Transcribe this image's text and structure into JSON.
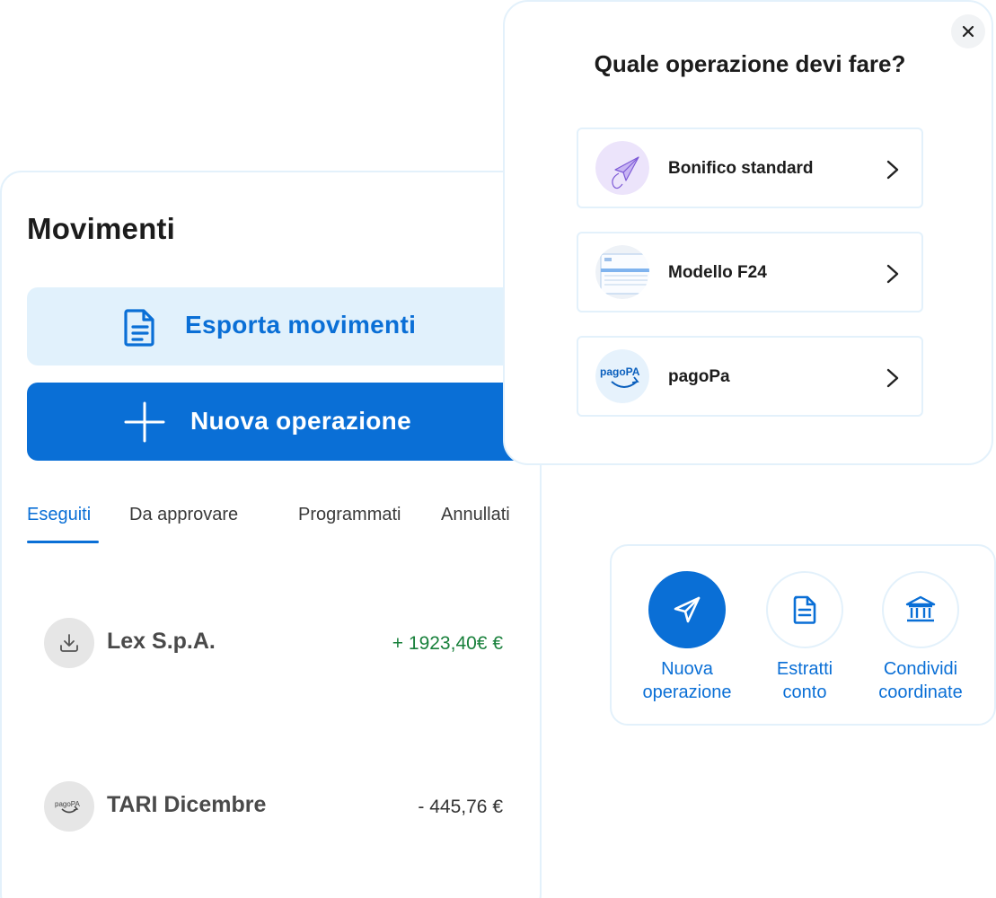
{
  "movimenti": {
    "title": "Movimenti",
    "export_label": "Esporta movimenti",
    "new_label": "Nuova operazione",
    "tabs": [
      "Eseguiti",
      "Da approvare",
      "Programmati",
      "Annullati"
    ],
    "active_tab": "Eseguiti",
    "transactions": [
      {
        "name": "Lex S.p.A.",
        "amount": "+ 1923,40€ €",
        "icon": "download-icon",
        "direction": "in"
      },
      {
        "name": "TARI Dicembre",
        "amount": "- 445,76 €",
        "icon": "pagopa-logo-icon",
        "logo_text": "pagoPA",
        "direction": "out"
      }
    ]
  },
  "modal": {
    "title": "Quale operazione devi fare?",
    "options": [
      {
        "label": "Bonifico standard",
        "icon": "paper-plane-icon"
      },
      {
        "label": "Modello F24",
        "icon": "f24-form-icon"
      },
      {
        "label": "pagoPa",
        "icon": "pagopa-logo-icon",
        "logo_text": "pagoPA"
      }
    ]
  },
  "quick_actions": [
    {
      "label": "Nuova\noperazione",
      "icon": "send-icon",
      "filled": true
    },
    {
      "label": "Estratti\nconto",
      "icon": "document-icon",
      "filled": false
    },
    {
      "label": "Condividi\ncoordinate",
      "icon": "bank-icon",
      "filled": false
    }
  ],
  "colors": {
    "primary": "#0a6fd6",
    "primary_light": "#e1f1fc",
    "positive": "#18803b",
    "border": "#e3f1fb"
  }
}
